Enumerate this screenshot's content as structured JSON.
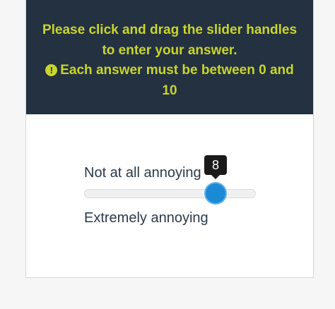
{
  "banner": {
    "line1": "Please click and drag the slider handles",
    "line2": "to enter your answer.",
    "warning_icon": "exclamation-circle-icon",
    "warning_glyph": "!",
    "line3": "Each answer must be between 0 and",
    "line4": "10"
  },
  "slider": {
    "low_label": "Not at all annoying",
    "high_label": "Extremely annoying",
    "value": "8",
    "min": 0,
    "max": 10,
    "value_numeric": 8
  },
  "colors": {
    "banner_bg": "#233140",
    "banner_text": "#c9d52b",
    "handle": "#1a8ad6",
    "tooltip_bg": "#1a1a1a"
  }
}
